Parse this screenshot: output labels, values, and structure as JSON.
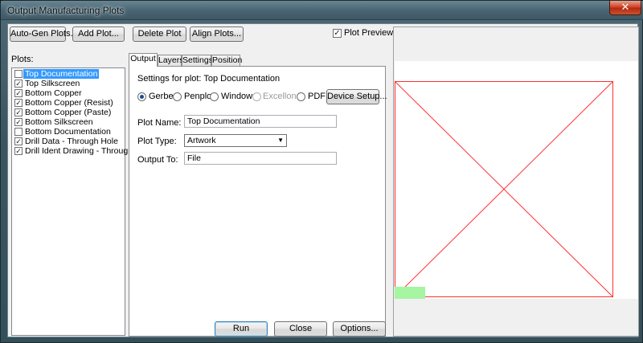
{
  "window": {
    "title": "Output Manufacturing Plots",
    "close_glyph": "✕"
  },
  "toolbar": {
    "auto_gen": "Auto-Gen Plots...",
    "add_plot": "Add Plot...",
    "delete_plot": "Delete Plot",
    "align_plots": "Align Plots...",
    "plot_preview_label": "Plot Preview",
    "plot_preview_checked": true
  },
  "plots": {
    "label": "Plots:",
    "items": [
      {
        "label": "Top Documentation",
        "checked": false,
        "selected": true
      },
      {
        "label": "Top Silkscreen",
        "checked": true,
        "selected": false
      },
      {
        "label": "Bottom Copper",
        "checked": true,
        "selected": false
      },
      {
        "label": "Bottom Copper (Resist)",
        "checked": true,
        "selected": false
      },
      {
        "label": "Bottom Copper (Paste)",
        "checked": true,
        "selected": false
      },
      {
        "label": "Bottom Silkscreen",
        "checked": true,
        "selected": false
      },
      {
        "label": "Bottom Documentation",
        "checked": false,
        "selected": false
      },
      {
        "label": "Drill Data - Through Hole",
        "checked": true,
        "selected": false
      },
      {
        "label": "Drill Ident Drawing - Through Hole",
        "checked": true,
        "selected": false
      }
    ]
  },
  "tabs": [
    {
      "label": "Output",
      "active": true
    },
    {
      "label": "Layers",
      "active": false
    },
    {
      "label": "Settings",
      "active": false
    },
    {
      "label": "Position",
      "active": false
    }
  ],
  "settings": {
    "heading": "Settings for plot: Top Documentation",
    "formats": [
      {
        "label": "Gerber",
        "selected": true,
        "enabled": true
      },
      {
        "label": "Penplot",
        "selected": false,
        "enabled": true
      },
      {
        "label": "Windows",
        "selected": false,
        "enabled": true
      },
      {
        "label": "Excellon",
        "selected": false,
        "enabled": false
      },
      {
        "label": "PDF",
        "selected": false,
        "enabled": true
      }
    ],
    "device_setup": "Device Setup...",
    "plot_name_label": "Plot Name:",
    "plot_name_value": "Top Documentation",
    "plot_type_label": "Plot Type:",
    "plot_type_value": "Artwork",
    "output_to_label": "Output To:",
    "output_to_value": "File"
  },
  "footer": {
    "run": "Run",
    "close": "Close",
    "options": "Options..."
  },
  "colors": {
    "preview_outline": "#ff3030",
    "origin_marker": "#a6f5a0",
    "selection": "#3399ff"
  }
}
